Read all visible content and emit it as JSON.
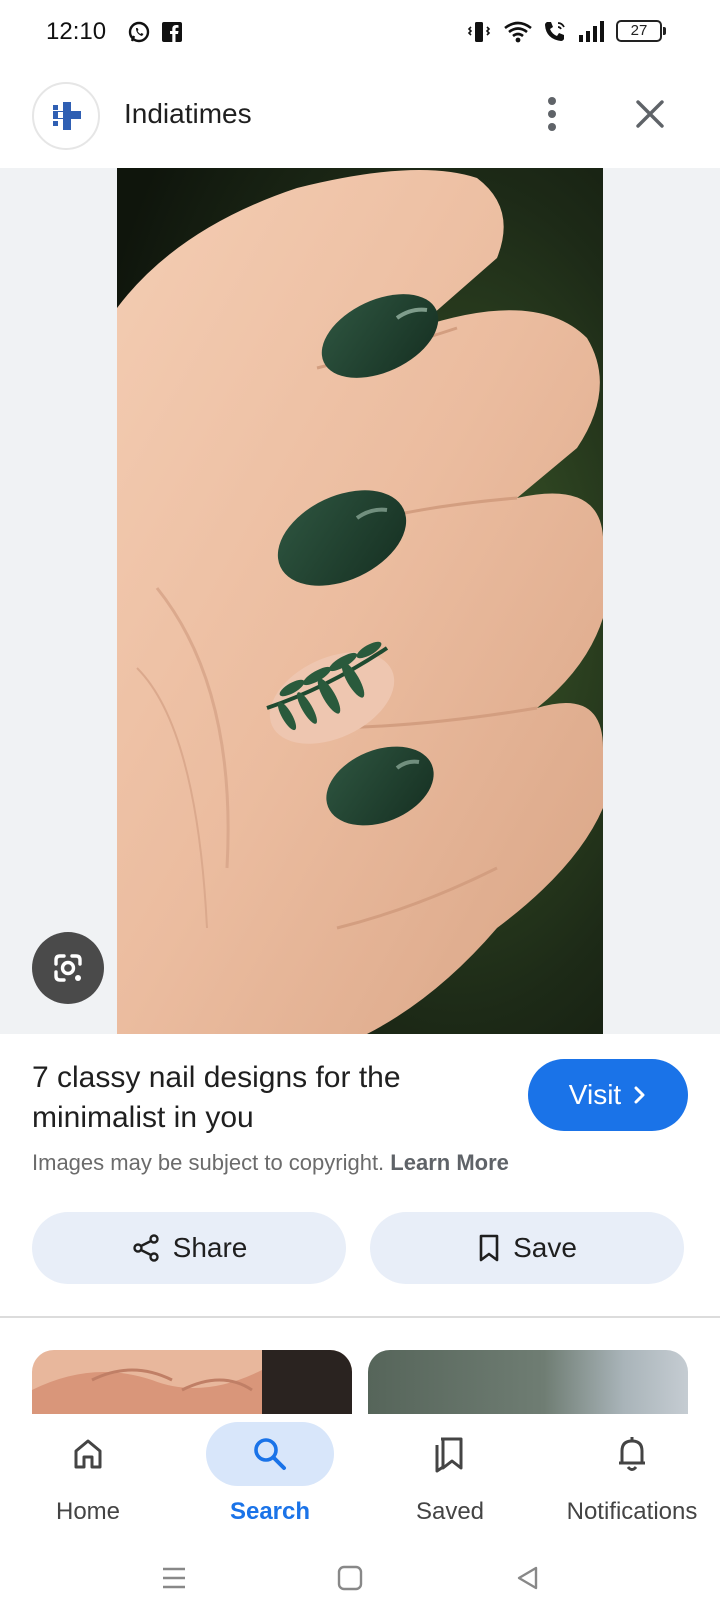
{
  "status_bar": {
    "time": "12:10",
    "left_icons": [
      "whatsapp-icon",
      "facebook-icon"
    ],
    "right_icons": [
      "vibrate-icon",
      "wifi-icon",
      "wifi-calling-icon",
      "signal-icon"
    ],
    "battery": "27"
  },
  "header": {
    "site_name": "Indiatimes",
    "logo_icon": "indiatimes-logo-icon"
  },
  "image": {
    "description_icon": "nail-photo"
  },
  "info": {
    "title": "7 classy nail designs for the minimalist in you",
    "visit_label": "Visit",
    "copyright_text": "Images may be subject to copyright.",
    "learn_more_label": "Learn More"
  },
  "actions": {
    "share_label": "Share",
    "save_label": "Save"
  },
  "bottom_nav": {
    "items": [
      {
        "label": "Home",
        "icon": "home-icon",
        "active": false
      },
      {
        "label": "Search",
        "icon": "search-icon",
        "active": true
      },
      {
        "label": "Saved",
        "icon": "saved-icon",
        "active": false
      },
      {
        "label": "Notifications",
        "icon": "bell-icon",
        "active": false
      }
    ]
  },
  "colors": {
    "accent": "#1a73e8",
    "pill": "#e8eef8",
    "active_nav_pill": "#d8e6fa",
    "nail_green": "#1f3d2c"
  }
}
